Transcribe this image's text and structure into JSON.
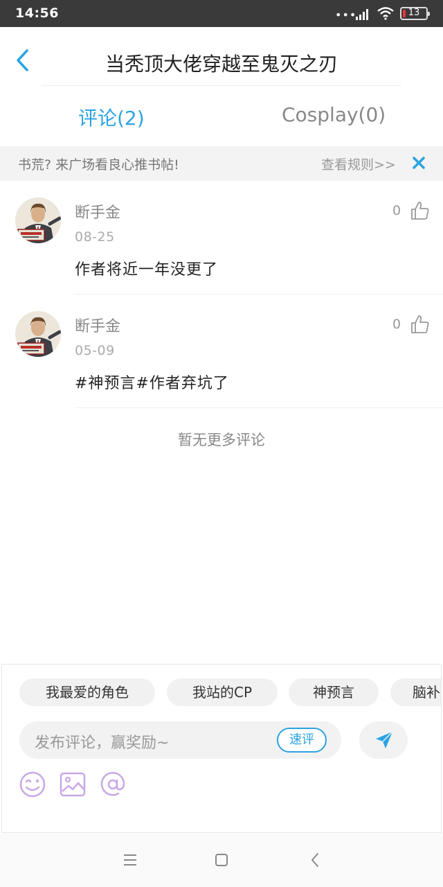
{
  "status_bar": {
    "time": "14:56",
    "dots": "•••",
    "battery_level": "13",
    "battery_color": "#e53935"
  },
  "header": {
    "title": "当秃顶大佬穿越至鬼灭之刃",
    "back_icon": "chevron-left-icon"
  },
  "tabs": [
    {
      "label": "评论(2)",
      "active": true
    },
    {
      "label": "Cosplay(0)",
      "active": false
    }
  ],
  "notice": {
    "text": "书荒? 来广场看良心推书帖!",
    "link": "查看规则>>",
    "close_icon": "close-icon"
  },
  "comments": [
    {
      "user": "断手金",
      "date": "08-25",
      "body": "作者将近一年没更了",
      "likes": "0"
    },
    {
      "user": "断手金",
      "date": "05-09",
      "body": "#神预言#作者弃坑了",
      "likes": "0"
    }
  ],
  "no_more": "暂无更多评论",
  "composer": {
    "tags": [
      "我最爱的角色",
      "我站的CP",
      "神预言",
      "脑补"
    ],
    "placeholder": "发布评论，赢奖励~",
    "quick_review": "速评",
    "send_icon": "send-icon",
    "tools": [
      "emoji-icon",
      "image-icon",
      "mention-icon"
    ]
  },
  "colors": {
    "accent": "#2aa3e0",
    "tool_icon": "#c9a7e6"
  }
}
